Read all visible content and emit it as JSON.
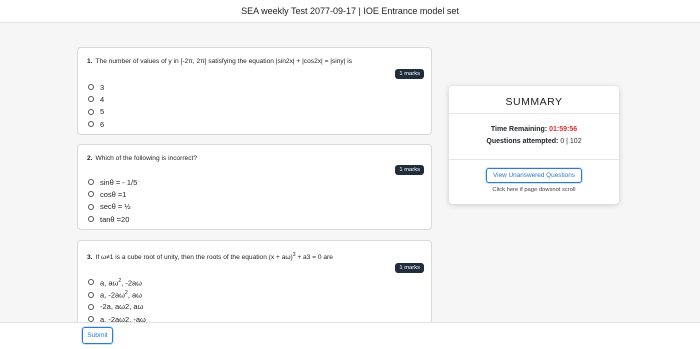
{
  "header": {
    "title": "SEA weekly Test 2077-09-17 | IOE Entrance model set"
  },
  "questions": [
    {
      "number": "1.",
      "text": "The number of values of y in [-2π, 2π] satisfying the equation |sin2x| + |cos2x| = |siny| is",
      "marks": "1 marks",
      "options": [
        "3",
        "4",
        "5",
        "6"
      ]
    },
    {
      "number": "2.",
      "text": "Which of the following is incorrect?",
      "marks": "1 marks",
      "options": [
        "sinθ = - 1/5",
        "cosθ =1",
        "secθ = ½",
        "tanθ =20"
      ]
    },
    {
      "number": "3.",
      "text_a": "If ω≠1 is a cube root of unity, then the roots of the equation (x + aω)",
      "text_sup": "3",
      "text_b": " + a3 = 0 are",
      "marks": "1 marks",
      "options": [
        {
          "a": "a, aω",
          "sup": "2",
          "b": ", -2aω"
        },
        {
          "a": "a, -2aω",
          "sup": "2",
          "b": ", aω"
        },
        {
          "a": "-2a, aω2, aω",
          "sup": "",
          "b": ""
        },
        {
          "a": "a, -2aω2, -aω",
          "sup": "",
          "b": ""
        }
      ]
    }
  ],
  "summary": {
    "title": "SUMMARY",
    "time_label": "Time Remaining:",
    "time_value": "01:59:56",
    "attempted_label": "Questions attempted:",
    "attempted_value": "0 | 102",
    "unanswered_button": "View Unanswered Questions",
    "hint": "Click here if page dowsnot scroll"
  },
  "footer": {
    "submit_label": "Submit"
  },
  "colors": {
    "accent": "#2c7ad6",
    "timer": "#d23030",
    "badge": "#1f2d3d"
  }
}
